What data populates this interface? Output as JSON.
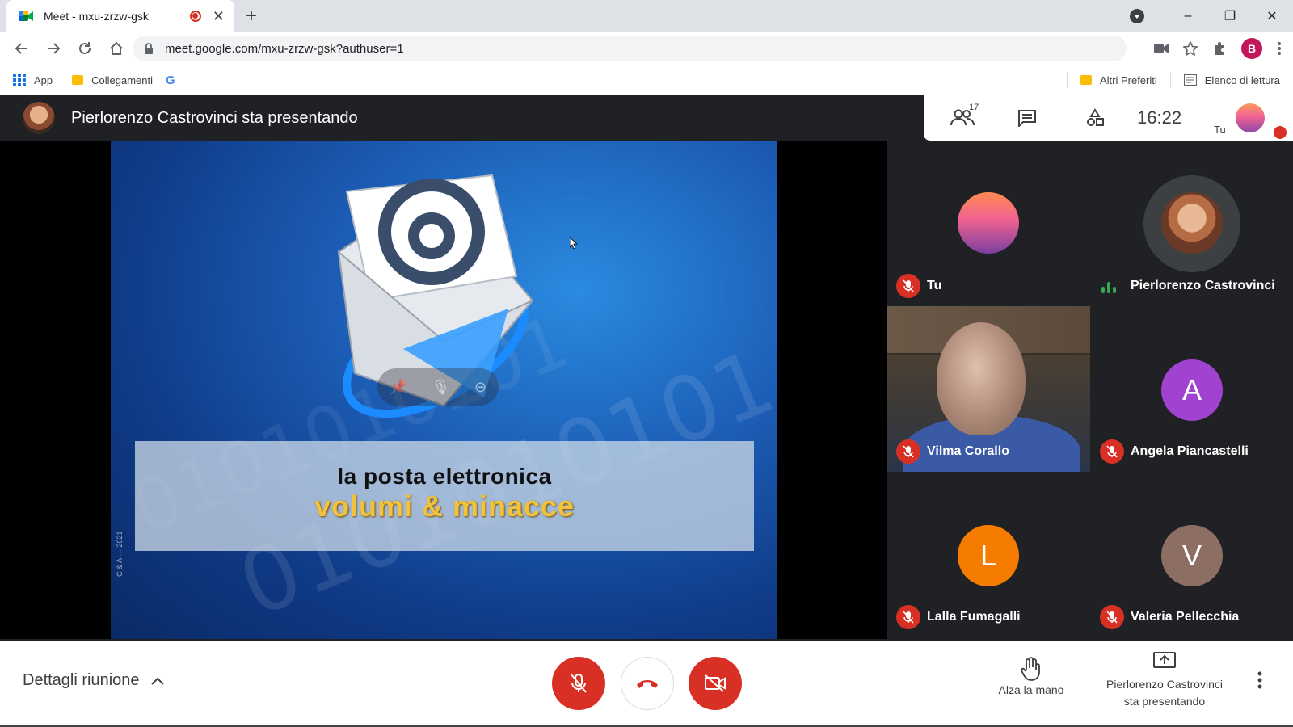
{
  "browser": {
    "tab_title": "Meet - mxu-zrzw-gsk",
    "tab_close": "✕",
    "new_tab": "+",
    "url": "meet.google.com/mxu-zrzw-gsk?authuser=1",
    "profile_initial": "B",
    "bookmarks": {
      "apps": "App",
      "collegamenti": "Collegamenti",
      "google": "G",
      "altri_preferiti": "Altri Preferiti",
      "elenco_lettura": "Elenco di lettura"
    },
    "window_controls": {
      "minimize": "–",
      "restore": "❐",
      "close": "✕"
    }
  },
  "meet": {
    "presenter_banner": "Pierlorenzo Castrovinci sta presentando",
    "people_count": "17",
    "clock": "16:22",
    "self_label": "Tu",
    "slide": {
      "line1": "la posta elettronica",
      "line2": "volumi & minacce",
      "binary_watermark": "0101010101",
      "copyright": "C & A — 2021"
    },
    "participants": [
      {
        "name": "Tu",
        "kind": "photo",
        "muted": true
      },
      {
        "name": "Pierlorenzo Castrovinci",
        "kind": "photo",
        "muted": false,
        "speaking": true
      },
      {
        "name": "Vilma Corallo",
        "kind": "video",
        "muted": true
      },
      {
        "name": "Angela Piancastelli",
        "kind": "letter",
        "letter": "A",
        "color": "#a142d1",
        "muted": true
      },
      {
        "name": "Lalla Fumagalli",
        "kind": "letter",
        "letter": "L",
        "color": "#f57c00",
        "muted": true
      },
      {
        "name": "Valeria Pellecchia",
        "kind": "letter",
        "letter": "V",
        "color": "#8d6e63",
        "muted": true
      }
    ],
    "bottom": {
      "details": "Dettagli riunione",
      "raise_hand": "Alza la mano",
      "presenting_line1": "Pierlorenzo Castrovinci",
      "presenting_line2": "sta presentando"
    }
  },
  "colors": {
    "danger": "#d93025",
    "accent": "#1a73e8",
    "speaking": "#34a853"
  }
}
